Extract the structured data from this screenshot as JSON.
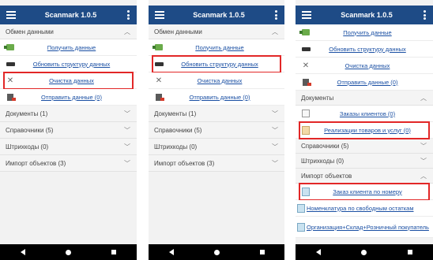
{
  "app": {
    "title": "Scanmark 1.0.5"
  },
  "screen1": {
    "exchange": {
      "title": "Обмен данными",
      "items": [
        {
          "label": "Получить данные"
        },
        {
          "label": "Обновить структуру данных"
        },
        {
          "label": "Очистка данных"
        },
        {
          "label": "Отправить данные (0)"
        }
      ]
    },
    "sections": [
      {
        "title": "Документы (1)"
      },
      {
        "title": "Справочники (5)"
      },
      {
        "title": "Штрихкоды (0)"
      },
      {
        "title": "Импорт объектов (3)"
      }
    ]
  },
  "screen2": {
    "exchange": {
      "title": "Обмен данными",
      "items": [
        {
          "label": "Получить данные"
        },
        {
          "label": "Обновить структуру данных"
        },
        {
          "label": "Очистка данных"
        },
        {
          "label": "Отправить данные (0)"
        }
      ]
    },
    "sections": [
      {
        "title": "Документы (1)"
      },
      {
        "title": "Справочники (5)"
      },
      {
        "title": "Штрихкоды (0)"
      },
      {
        "title": "Импорт объектов (3)"
      }
    ]
  },
  "screen3": {
    "exchange_items": [
      {
        "label": "Получить данные"
      },
      {
        "label": "Обновить структуру данных"
      },
      {
        "label": "Очистка данных"
      },
      {
        "label": "Отправить данные (0)"
      }
    ],
    "documents": {
      "title": "Документы",
      "items": [
        {
          "label": "Заказы клиентов (0)"
        },
        {
          "label": "Реализации товаров и услуг (0)"
        }
      ]
    },
    "refs": {
      "title": "Справочники (5)"
    },
    "barcodes": {
      "title": "Штрихкоды (0)"
    },
    "import": {
      "title": "Импорт объектов",
      "items": [
        {
          "label": "Заказ клиента по номеру"
        },
        {
          "label": "Номенклатура по свободным остаткам"
        },
        {
          "label": "Организация+Склад+Розничный покупатель"
        }
      ]
    }
  },
  "colors": {
    "appbar": "#1e4b86",
    "highlight": "#e22727",
    "link": "#1a4fa3"
  }
}
